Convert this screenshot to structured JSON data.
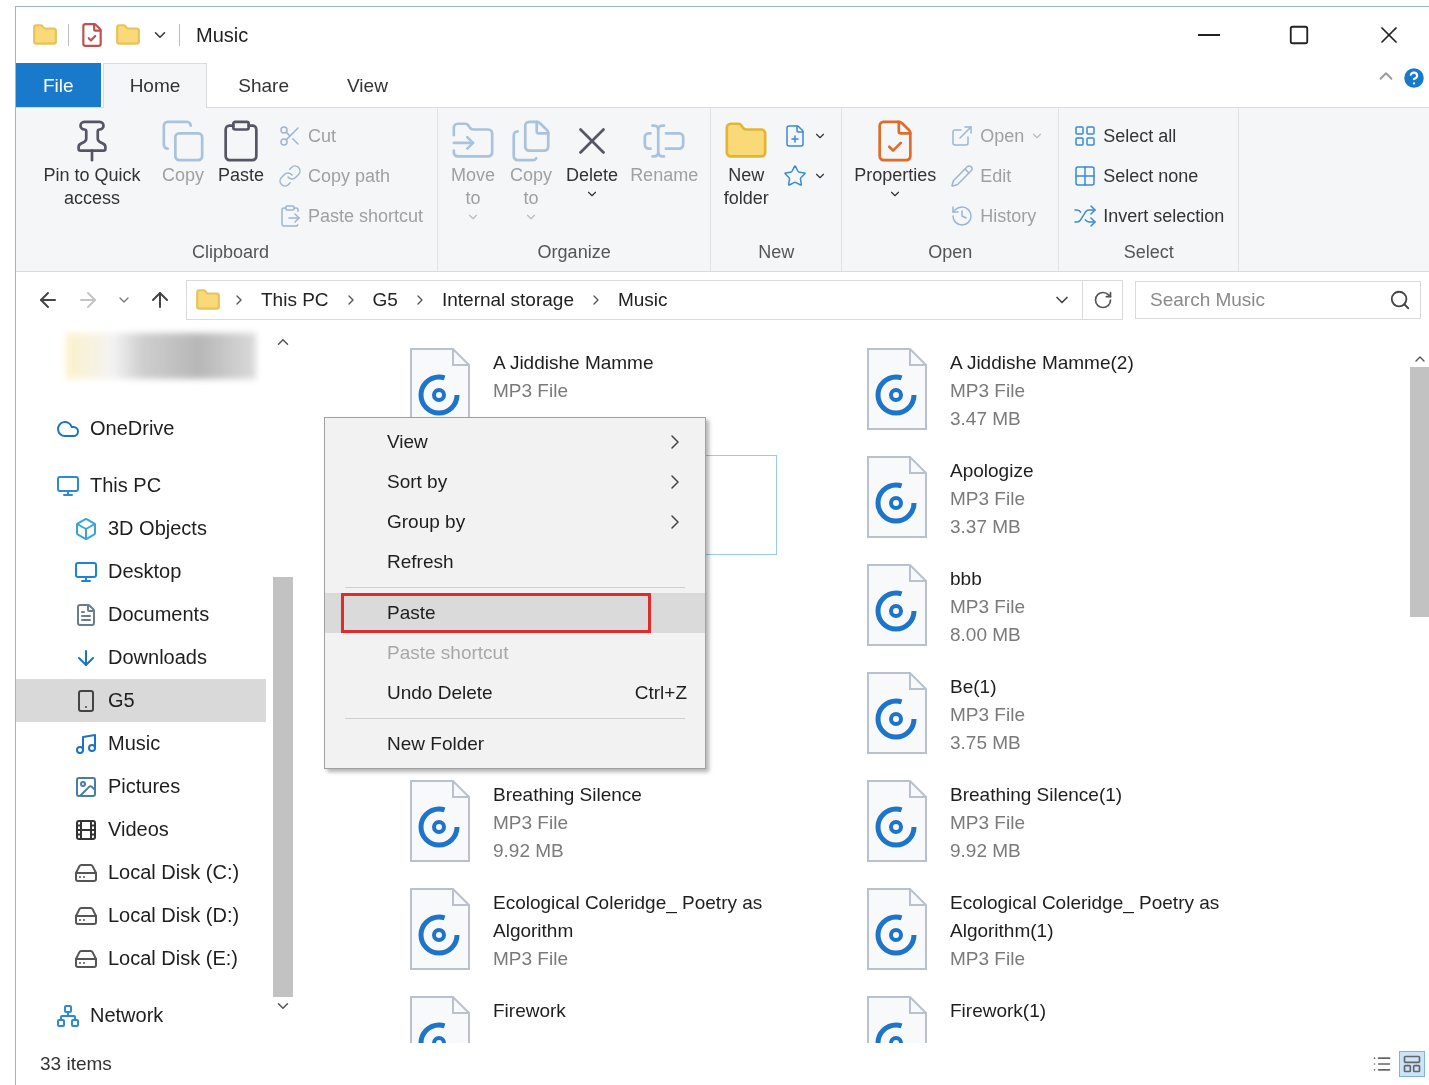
{
  "title_bar": {
    "title": "Music"
  },
  "ribbon_tabs": [
    {
      "label": "File",
      "kind": "file",
      "selected": false
    },
    {
      "label": "Home",
      "kind": "tab",
      "selected": true
    },
    {
      "label": "Share",
      "kind": "tab",
      "selected": false
    },
    {
      "label": "View",
      "kind": "tab",
      "selected": false
    }
  ],
  "ribbon_groups": [
    {
      "label": "Clipboard",
      "large": [
        {
          "label": "Pin to Quick access",
          "disabled": false,
          "dropdown": false
        },
        {
          "label": "Copy",
          "disabled": true,
          "dropdown": false
        },
        {
          "label": "Paste",
          "disabled": false,
          "dropdown": false
        }
      ],
      "small": [
        {
          "label": "Cut",
          "disabled": true,
          "dropdown": false
        },
        {
          "label": "Copy path",
          "disabled": true,
          "dropdown": false
        },
        {
          "label": "Paste shortcut",
          "disabled": true,
          "dropdown": false
        }
      ]
    },
    {
      "label": "Organize",
      "large": [
        {
          "label": "Move to",
          "disabled": true,
          "dropdown": true
        },
        {
          "label": "Copy to",
          "disabled": true,
          "dropdown": true
        },
        {
          "label": "Delete",
          "disabled": false,
          "dropdown": true
        },
        {
          "label": "Rename",
          "disabled": true,
          "dropdown": false
        }
      ]
    },
    {
      "label": "New",
      "large": [
        {
          "label": "New folder",
          "disabled": false,
          "dropdown": false
        }
      ],
      "small": [
        {
          "disabled": false,
          "dropdown": true
        },
        {
          "disabled": false,
          "dropdown": true
        }
      ]
    },
    {
      "label": "Open",
      "large": [
        {
          "label": "Properties",
          "disabled": false,
          "dropdown": true
        }
      ],
      "small": [
        {
          "label": "Open",
          "disabled": true,
          "dropdown": true
        },
        {
          "label": "Edit",
          "disabled": true,
          "dropdown": false
        },
        {
          "label": "History",
          "disabled": true,
          "dropdown": false
        }
      ]
    },
    {
      "label": "Select",
      "small": [
        {
          "label": "Select all",
          "disabled": false,
          "dropdown": false
        },
        {
          "label": "Select none",
          "disabled": false,
          "dropdown": false
        },
        {
          "label": "Invert selection",
          "disabled": false,
          "dropdown": false
        }
      ]
    }
  ],
  "address": {
    "path": [
      "This PC",
      "G5",
      "Internal storage",
      "Music"
    ],
    "search": {
      "placeholder": "Search Music"
    }
  },
  "sidebar": [
    {
      "label": "OneDrive",
      "selected": false
    },
    {
      "label": "This PC",
      "selected": false,
      "children": [
        {
          "label": "3D Objects",
          "selected": false
        },
        {
          "label": "Desktop",
          "selected": false
        },
        {
          "label": "Documents",
          "selected": false
        },
        {
          "label": "Downloads",
          "selected": false
        },
        {
          "label": "G5",
          "selected": true
        },
        {
          "label": "Music",
          "selected": false
        },
        {
          "label": "Pictures",
          "selected": false
        },
        {
          "label": "Videos",
          "selected": false
        },
        {
          "label": "Local Disk (C:)",
          "selected": false
        },
        {
          "label": "Local Disk (D:)",
          "selected": false
        },
        {
          "label": "Local Disk (E:)",
          "selected": false
        }
      ]
    },
    {
      "label": "Network",
      "selected": false
    }
  ],
  "files": {
    "left": [
      {
        "kind": "file",
        "name": "A Jiddishe Mamme",
        "type": "MP3 File"
      },
      {
        "kind": "hidden",
        "focused": true
      },
      {
        "kind": "hidden",
        "focused": false
      },
      {
        "kind": "hidden",
        "focused": false
      },
      {
        "kind": "file",
        "name": "Breathing Silence",
        "type": "MP3 File",
        "size": "9.92 MB"
      },
      {
        "kind": "file",
        "name": "Ecological Coleridge_ Poetry as Algorithm",
        "type": "MP3 File"
      },
      {
        "kind": "file",
        "name": "Firework"
      }
    ],
    "right": [
      {
        "kind": "file",
        "name": "A Jiddishe Mamme(2)",
        "type": "MP3 File",
        "size": "3.47 MB"
      },
      {
        "kind": "file",
        "name": "Apologize",
        "type": "MP3 File",
        "size": "3.37 MB"
      },
      {
        "kind": "file",
        "name": "bbb",
        "type": "MP3 File",
        "size": "8.00 MB"
      },
      {
        "kind": "file",
        "name": "Be(1)",
        "type": "MP3 File",
        "size": "3.75 MB"
      },
      {
        "kind": "file",
        "name": "Breathing Silence(1)",
        "type": "MP3 File",
        "size": "9.92 MB"
      },
      {
        "kind": "file",
        "name": "Ecological Coleridge_ Poetry as Algorithm(1)",
        "type": "MP3 File"
      },
      {
        "kind": "file",
        "name": "Firework(1)"
      }
    ]
  },
  "context_menu": [
    {
      "kind": "submenu",
      "label": "View",
      "disabled": false,
      "highlighted": false,
      "annotated": false
    },
    {
      "kind": "submenu",
      "label": "Sort by",
      "disabled": false,
      "highlighted": false,
      "annotated": false
    },
    {
      "kind": "submenu",
      "label": "Group by",
      "disabled": false,
      "highlighted": false,
      "annotated": false
    },
    {
      "kind": "item",
      "label": "Refresh",
      "disabled": false,
      "highlighted": false,
      "annotated": false
    },
    {
      "kind": "separator"
    },
    {
      "kind": "item",
      "label": "Paste",
      "disabled": false,
      "highlighted": true,
      "annotated": true
    },
    {
      "kind": "item",
      "label": "Paste shortcut",
      "disabled": true,
      "highlighted": false,
      "annotated": false
    },
    {
      "kind": "item",
      "label": "Undo Delete",
      "shortcut": "Ctrl+Z",
      "disabled": false,
      "highlighted": false,
      "annotated": false
    },
    {
      "kind": "separator"
    },
    {
      "kind": "item",
      "label": "New Folder",
      "disabled": false,
      "highlighted": false,
      "annotated": false
    }
  ],
  "status_bar": {
    "count": "33 items",
    "views": [
      {
        "selected": false
      },
      {
        "selected": true
      }
    ]
  }
}
